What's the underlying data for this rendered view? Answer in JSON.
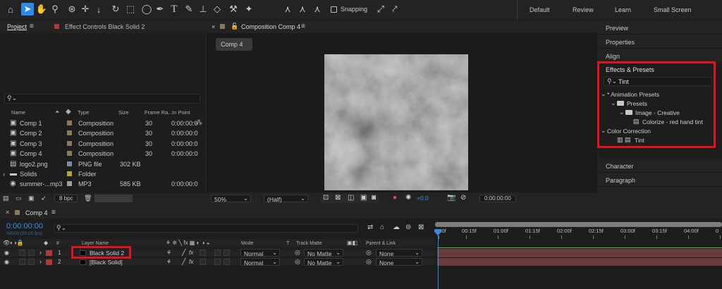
{
  "toolbar": {
    "snapping_label": "Snapping",
    "workspaces": [
      "Default",
      "Review",
      "Learn",
      "Small Screen"
    ]
  },
  "project": {
    "tab_label": "Project",
    "effect_controls_label": "Effect Controls Black Solid 2",
    "search_placeholder": "",
    "columns": [
      "Name",
      "Type",
      "Size",
      "Frame Ra...",
      "In Point"
    ],
    "rows": [
      {
        "name": "Comp 1",
        "type": "Composition",
        "size": "",
        "fps": "30",
        "in": "0:00:00:0",
        "color": "#8a7a5a",
        "icon": "comp-icon"
      },
      {
        "name": "Comp 2",
        "type": "Composition",
        "size": "",
        "fps": "30",
        "in": "0:00:00:0",
        "color": "#8a7a5a",
        "icon": "comp-icon"
      },
      {
        "name": "Comp 3",
        "type": "Composition",
        "size": "",
        "fps": "30",
        "in": "0:00:00:0",
        "color": "#8a7a5a",
        "icon": "comp-icon"
      },
      {
        "name": "Comp 4",
        "type": "Composition",
        "size": "",
        "fps": "30",
        "in": "0:00:00:0",
        "color": "#8a7a5a",
        "icon": "comp-icon"
      },
      {
        "name": "logo2.png",
        "type": "PNG file",
        "size": "302 KB",
        "fps": "",
        "in": "",
        "color": "#7a8aa8",
        "icon": "png-icon"
      },
      {
        "name": "Solids",
        "type": "Folder",
        "size": "",
        "fps": "",
        "in": "",
        "color": "#b5a83a",
        "icon": "folder-icon"
      },
      {
        "name": "summer-...mp3",
        "type": "MP3",
        "size": "585 KB",
        "fps": "",
        "in": "0:00:00:0",
        "color": "#9aa0a8",
        "icon": "audio-icon"
      }
    ],
    "bpc_label": "8 bpc"
  },
  "composition": {
    "tab_label": "Composition Comp 4",
    "breadcrumb": "Comp 4",
    "zoom": "50%",
    "resolution": "(Half)",
    "exposure": "+0.0",
    "timecode": "0:00:00:00"
  },
  "right_panel": {
    "preview": "Preview",
    "properties": "Properties",
    "align": "Align",
    "effects_presets": "Effects & Presets",
    "search_value": "Tint",
    "tree": [
      {
        "label": "* Animation Presets",
        "level": 0,
        "kind": "group"
      },
      {
        "label": "Presets",
        "level": 1,
        "kind": "folder"
      },
      {
        "label": "Image - Creative",
        "level": 2,
        "kind": "folder"
      },
      {
        "label": "Colorize - red hand tint",
        "level": 3,
        "kind": "preset"
      },
      {
        "label": "Color Correction",
        "level": 0,
        "kind": "group"
      },
      {
        "label": "Tint",
        "level": 1,
        "kind": "effect"
      }
    ],
    "character": "Character",
    "paragraph": "Paragraph"
  },
  "timeline": {
    "tab_label": "Comp 4",
    "timecode": "0:00:00:00",
    "fps_label": "00000 (30.00 fps)",
    "columns": {
      "num": "#",
      "layer_name": "Layer Name",
      "mode": "Mode",
      "t": "T",
      "track_matte": "Track Matte",
      "parent": "Parent & Link"
    },
    "ruler": [
      "0:00f",
      "00:15f",
      "01:00f",
      "01:15f",
      "02:00f",
      "02:15f",
      "03:00f",
      "03:15f",
      "04:00f",
      "0"
    ],
    "layers": [
      {
        "num": "1",
        "name": "Black Solid 2",
        "mode": "Normal",
        "matte": "No Matte",
        "parent": "None"
      },
      {
        "num": "2",
        "name": "[Black Solid]",
        "mode": "Normal",
        "matte": "No Matte",
        "parent": "None"
      }
    ]
  },
  "colors": {
    "accent_blue": "#2d8ceb",
    "highlight_red": "#e0141e",
    "label_red": "#b03a3a",
    "track_red": "#6b3a3a",
    "timecode_blue": "#3a8ee6"
  }
}
